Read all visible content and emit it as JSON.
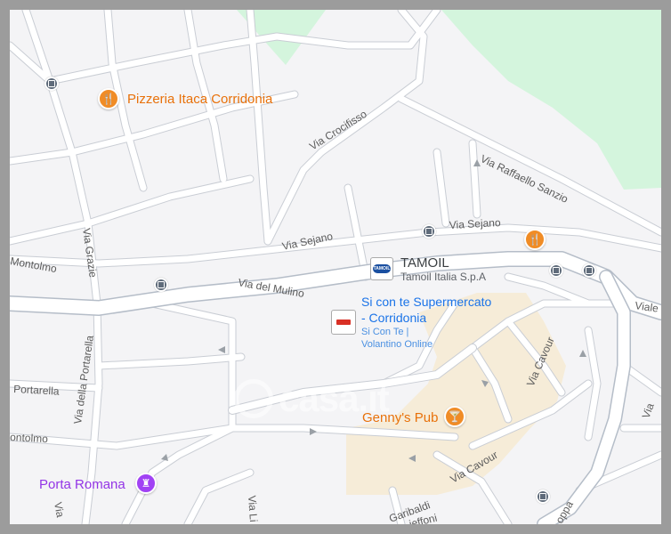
{
  "map": {
    "streets": {
      "via_crocifisso": "Via Crocifisso",
      "via_raffaello_sanzio": "Via Raffaello Sanzio",
      "via_sejano_1": "Via Sejano",
      "via_sejano_2": "Via Sejano",
      "via_del_mulino": "Via del Mulino",
      "via_grazie": "Via Grazie",
      "montolmo_1": "Montolmo",
      "montolmo_2": "ontolmo",
      "via_della_portarella": "Via della Portarella",
      "portarella": "Portarella",
      "via_cavour_1": "Via Cavour",
      "via_cavour_2": "Via Cavour",
      "viale": "Viale",
      "via_li": "Via Li",
      "garibaldi": "Garibaldi",
      "ieffoni": "ieffoni",
      "via_edge_left": "Via",
      "oppa": "oppa"
    },
    "pois": {
      "pizzeria": {
        "name": "Pizzeria Itaca Corridonia",
        "color": "#e8710a"
      },
      "tamoil": {
        "name": "TAMOIL",
        "subtitle": "Tamoil Italia S.p.A",
        "logo_text": "TAMOIL"
      },
      "supermercato": {
        "name_line1": "Si con te Supermercato",
        "name_line2": "- Corridonia",
        "sub_line1": "Si Con Te |",
        "sub_line2": "Volantino Online",
        "color": "#1a73e8"
      },
      "gennys": {
        "name": "Genny's Pub",
        "color": "#e8710a"
      },
      "porta_romana": {
        "name": "Porta Romana",
        "color": "#9334e6"
      }
    },
    "watermark": "casa.it",
    "colors": {
      "park": "#d4f5dd",
      "pedestrian_area": "#f6ecd8",
      "road": "#ffffff",
      "road_edge": "#c9cdd4",
      "main_road_edge": "#b5bdc8"
    }
  }
}
